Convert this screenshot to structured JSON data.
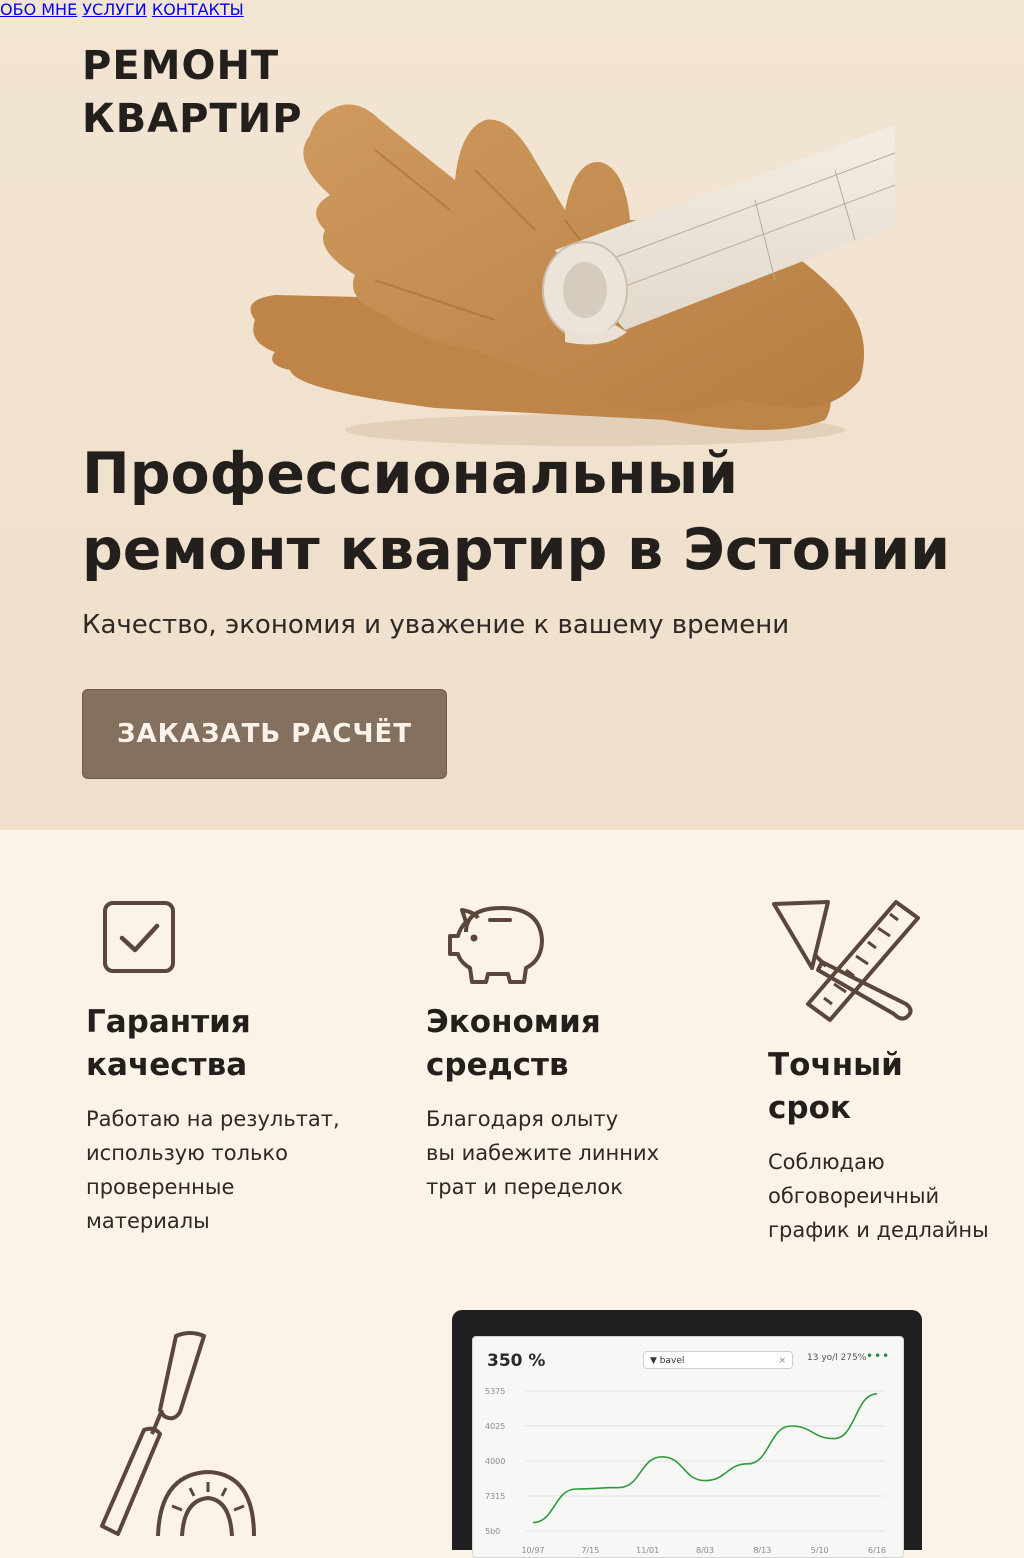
{
  "header": {
    "logo": "РЕМОНТ\nКВАРТИР",
    "nav": [
      "ОБО МНЕ",
      "УСЛУГИ",
      "КОНТАКТЫ"
    ]
  },
  "hero": {
    "title": "Профессиональный ремонт квартир в Эстонии",
    "subtitle": "Качество, экономия и уважение к вашему времени",
    "cta": "ЗАКАЗАТЬ РАСЧЁТ"
  },
  "features": [
    {
      "icon": "checkbox-icon",
      "title": "Гарантия\nкачества",
      "desc": "Работаю на результат,\nиспользую только\nпроверенные\nматериалы"
    },
    {
      "icon": "piggy-bank-icon",
      "title": "Экономия\nсредств",
      "desc": "Благодаря олыту\nвы иабежите линних\nтрат и переделок"
    },
    {
      "icon": "trowel-ruler-icon",
      "title": "Точный\nсрок",
      "desc": "Соблюдаю\nобговореичный\nграфик и дедлайны"
    }
  ],
  "tools_icon": "trowel-protractor-icon",
  "dashboard": {
    "kpi": "350 %",
    "filter": "▼ bavel",
    "filter_close": "×",
    "range": "13 yo/l 275%",
    "menu": "•••"
  },
  "chart_data": {
    "type": "line",
    "y_ticks": [
      "5375",
      "4025",
      "4000",
      "7315",
      "5b0"
    ],
    "x_ticks": [
      "10/97",
      "7/15",
      "11/01",
      "8/03",
      "8/13",
      "5/10",
      "6/16"
    ],
    "series_color": "#2e9a3e",
    "values": [
      0.06,
      0.3,
      0.31,
      0.53,
      0.36,
      0.48,
      0.75,
      0.66,
      0.98
    ]
  },
  "colors": {
    "hero_bg": "#f2e4d1",
    "section_bg": "#fbf2e8",
    "accent": "#84705f",
    "icon_stroke": "#5a463a"
  }
}
